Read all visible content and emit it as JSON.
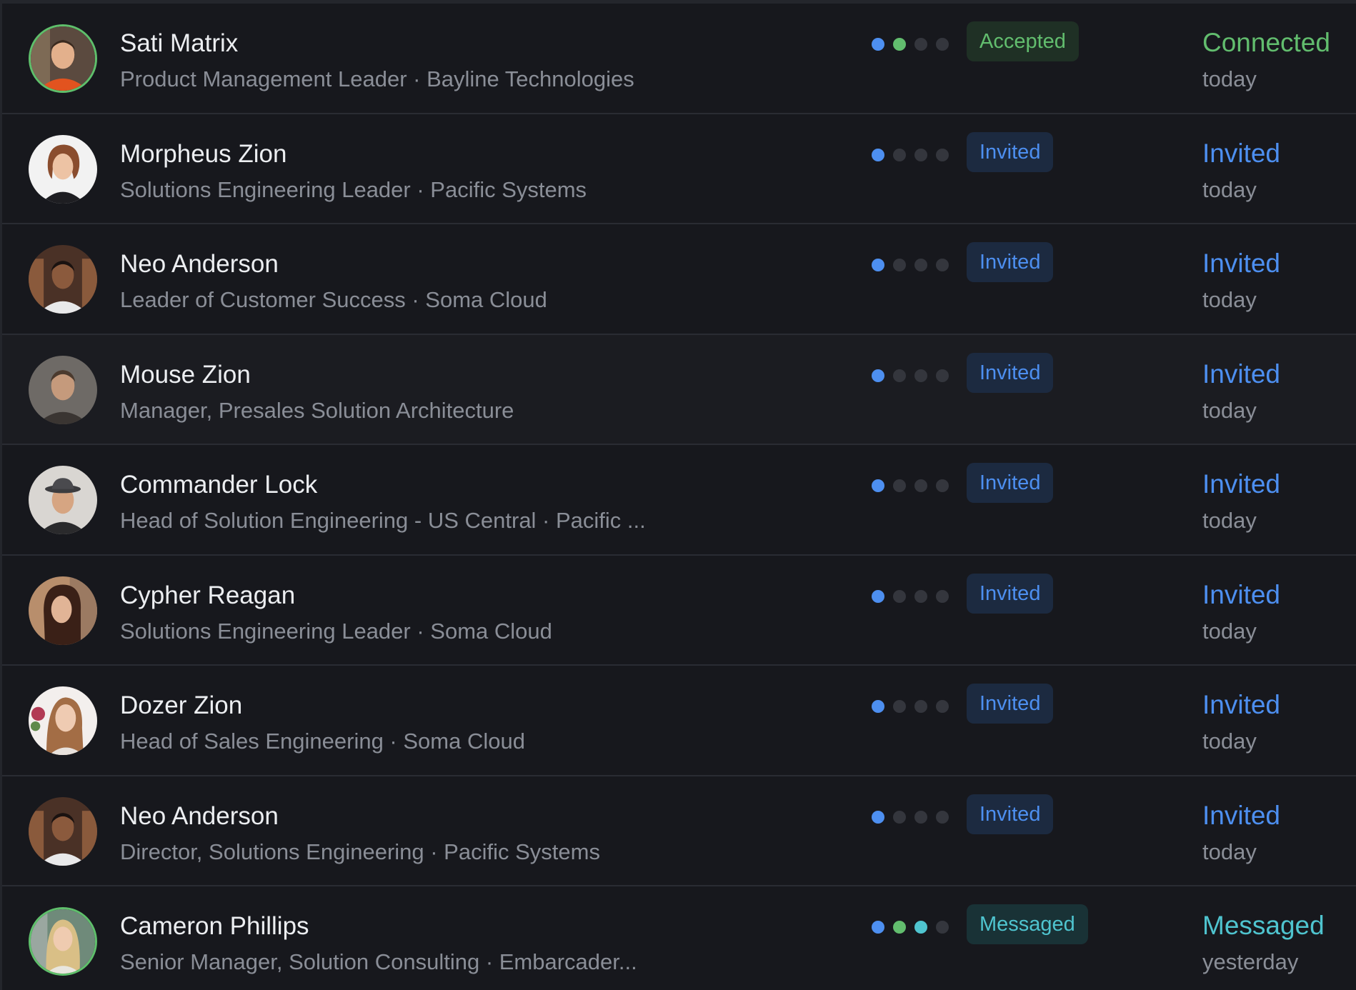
{
  "colors": {
    "background": "#17181d",
    "blue": "#4d8ff0",
    "green": "#62bd6e",
    "teal": "#4fc4cf",
    "dot_inactive": "#34363d",
    "muted_text": "#8a8e97"
  },
  "contacts": [
    {
      "name": "Sati Matrix",
      "subtitle": "Product Management Leader · Bayline Technologies",
      "badge": "Accepted",
      "status": "Connected",
      "when": "today",
      "avatar_icon": "avatar-photo-man-orange-sweater",
      "progress_dots": [
        "blue",
        "green",
        "inactive",
        "inactive"
      ]
    },
    {
      "name": "Morpheus Zion",
      "subtitle": "Solutions Engineering Leader · Pacific Systems",
      "badge": "Invited",
      "status": "Invited",
      "when": "today",
      "avatar_icon": "avatar-photo-woman-white-background",
      "progress_dots": [
        "blue",
        "inactive",
        "inactive",
        "inactive"
      ]
    },
    {
      "name": "Neo Anderson",
      "subtitle": "Leader of Customer Success · Soma Cloud",
      "badge": "Invited",
      "status": "Invited",
      "when": "today",
      "avatar_icon": "avatar-photo-man-white-shirt",
      "progress_dots": [
        "blue",
        "inactive",
        "inactive",
        "inactive"
      ]
    },
    {
      "name": "Mouse Zion",
      "subtitle": "Manager, Presales Solution Architecture",
      "badge": "Invited",
      "status": "Invited",
      "when": "today",
      "avatar_icon": "avatar-photo-man-grey",
      "progress_dots": [
        "blue",
        "inactive",
        "inactive",
        "inactive"
      ]
    },
    {
      "name": "Commander Lock",
      "subtitle": "Head of Solution Engineering - US Central · Pacific ...",
      "badge": "Invited",
      "status": "Invited",
      "when": "today",
      "avatar_icon": "avatar-photo-man-hat",
      "progress_dots": [
        "blue",
        "inactive",
        "inactive",
        "inactive"
      ]
    },
    {
      "name": "Cypher Reagan",
      "subtitle": "Solutions Engineering Leader · Soma Cloud",
      "badge": "Invited",
      "status": "Invited",
      "when": "today",
      "avatar_icon": "avatar-photo-woman-dark-hair",
      "progress_dots": [
        "blue",
        "inactive",
        "inactive",
        "inactive"
      ]
    },
    {
      "name": "Dozer Zion",
      "subtitle": "Head of Sales Engineering · Soma Cloud",
      "badge": "Invited",
      "status": "Invited",
      "when": "today",
      "avatar_icon": "avatar-photo-woman-flowers",
      "progress_dots": [
        "blue",
        "inactive",
        "inactive",
        "inactive"
      ]
    },
    {
      "name": "Neo Anderson",
      "subtitle": "Director, Solutions Engineering · Pacific Systems",
      "badge": "Invited",
      "status": "Invited",
      "when": "today",
      "avatar_icon": "avatar-photo-man-white-shirt",
      "progress_dots": [
        "blue",
        "inactive",
        "inactive",
        "inactive"
      ]
    },
    {
      "name": "Cameron Phillips",
      "subtitle": "Senior Manager, Solution Consulting · Embarcader...",
      "badge": "Messaged",
      "status": "Messaged",
      "when": "yesterday",
      "avatar_icon": "avatar-photo-woman-blonde",
      "progress_dots": [
        "blue",
        "green",
        "teal",
        "inactive"
      ]
    }
  ]
}
